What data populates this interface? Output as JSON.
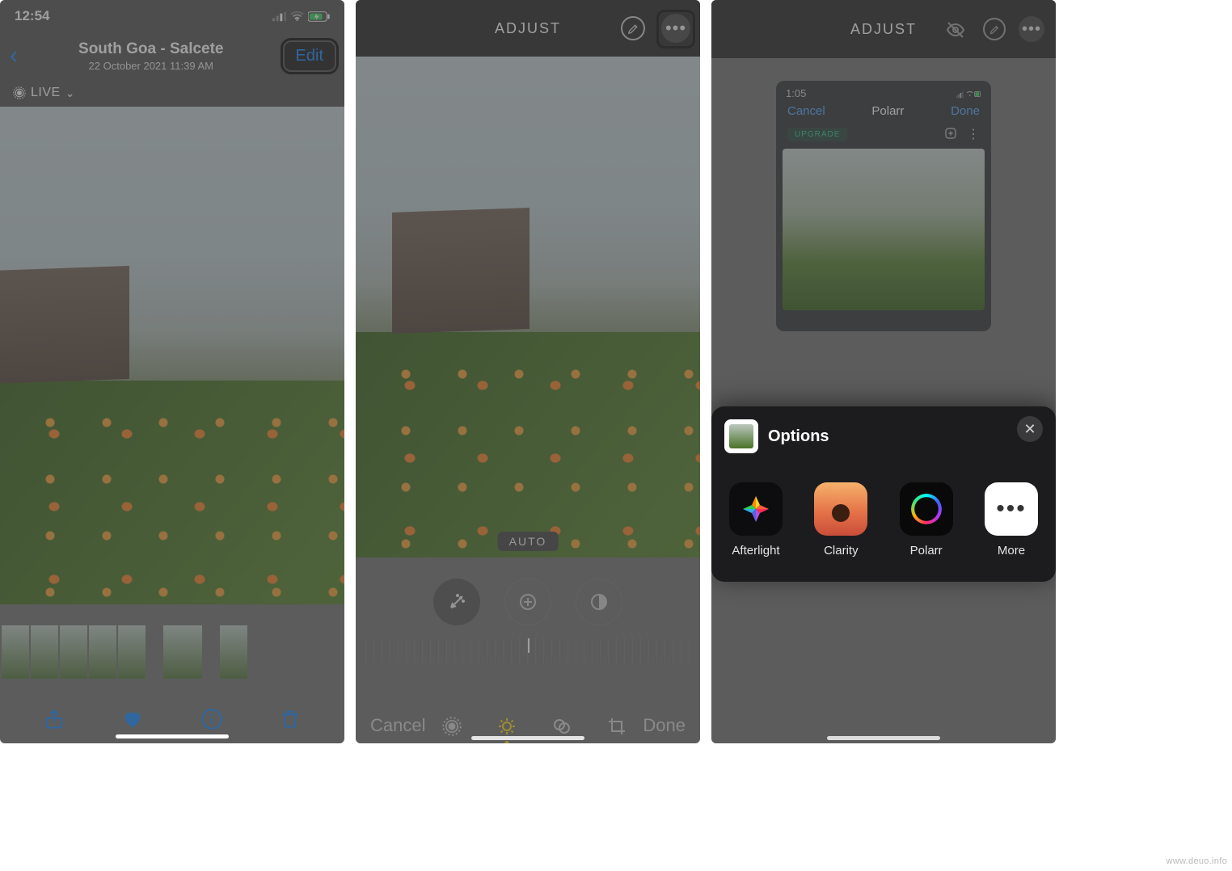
{
  "screen1": {
    "status_time": "12:54",
    "title": "South Goa - Salcete",
    "subtitle": "22 October 2021  11:39 AM",
    "edit_label": "Edit",
    "live_label": "LIVE"
  },
  "screen2": {
    "header": "ADJUST",
    "auto_label": "AUTO",
    "cancel": "Cancel",
    "done": "Done"
  },
  "screen3": {
    "header": "ADJUST",
    "polarr": {
      "status_time": "1:05",
      "cancel": "Cancel",
      "title": "Polarr",
      "done": "Done",
      "upgrade": "UPGRADE"
    },
    "sheet": {
      "title": "Options",
      "apps": {
        "afterlight": "Afterlight",
        "clarity": "Clarity",
        "polarr": "Polarr",
        "more": "More"
      }
    }
  },
  "watermark": "www.deuo.info"
}
